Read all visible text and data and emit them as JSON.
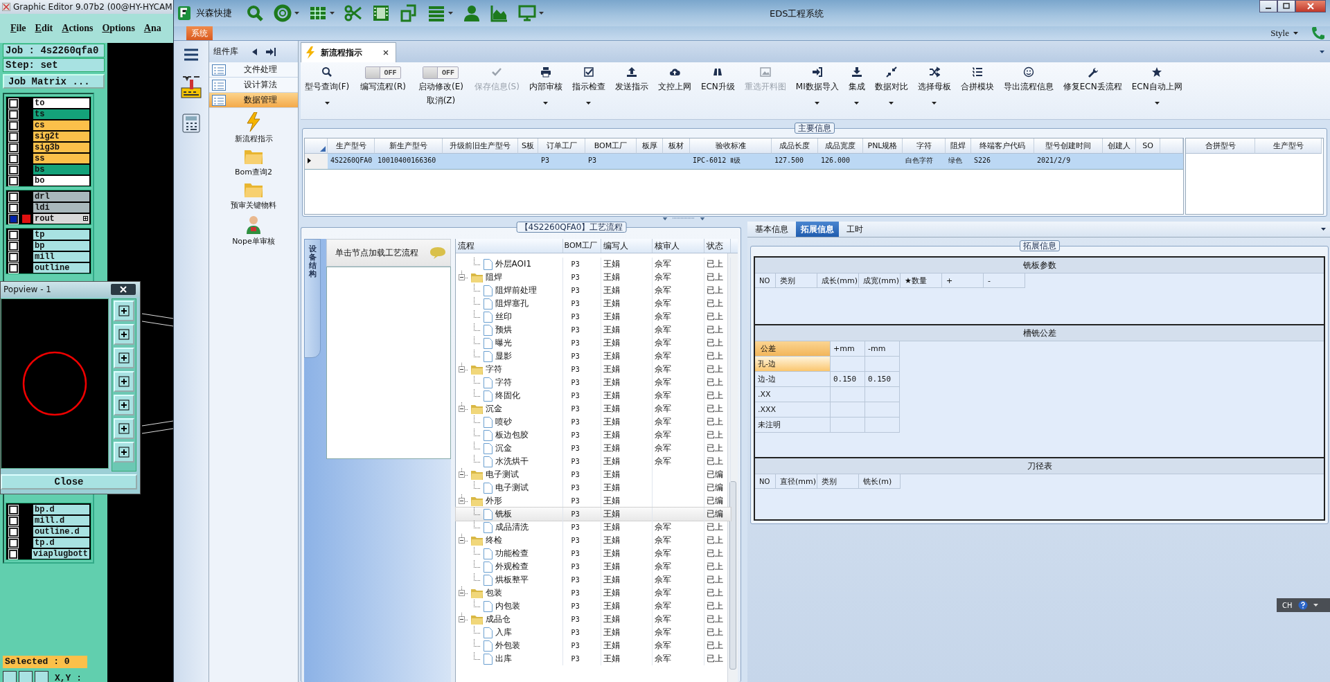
{
  "genesis": {
    "title": "Graphic Editor 9.07b2 (00@HY-HYCAM",
    "menu": [
      "File",
      "Edit",
      "Actions",
      "Options",
      "Ana"
    ],
    "job": "Job : 4s2260qfa0",
    "step": "Step: set",
    "matrix_button": "Job Matrix ...",
    "layer_groups": [
      [
        {
          "name": "to",
          "color": "#ffffff",
          "checked": false,
          "work_layer": false
        },
        {
          "name": "ts",
          "color": "#14a27a",
          "checked": false,
          "work_layer": false
        },
        {
          "name": "cs",
          "color": "#fbc04a",
          "checked": false,
          "work_layer": false
        },
        {
          "name": "sig2t",
          "color": "#fbc04a",
          "checked": false,
          "work_layer": false
        },
        {
          "name": "sig3b",
          "color": "#fbc04a",
          "checked": false,
          "work_layer": false
        },
        {
          "name": "ss",
          "color": "#fbc04a",
          "checked": false,
          "work_layer": false
        },
        {
          "name": "bs",
          "color": "#14a27a",
          "checked": false,
          "work_layer": false
        },
        {
          "name": "bo",
          "color": "#ffffff",
          "checked": false,
          "work_layer": false
        }
      ],
      [
        {
          "name": "drl",
          "color": "#a9b8bc",
          "checked": false,
          "work_layer": false
        },
        {
          "name": "ldi",
          "color": "#a9b8bc",
          "checked": false,
          "work_layer": false
        },
        {
          "name": "rout",
          "color": "#d9d9d9",
          "checked": true,
          "work_layer": true
        }
      ],
      [
        {
          "name": "tp",
          "color": "#a8e2e2",
          "checked": false,
          "work_layer": false
        },
        {
          "name": "bp",
          "color": "#a8e2e2",
          "checked": false,
          "work_layer": false
        },
        {
          "name": "mill",
          "color": "#a8e2e2",
          "checked": false,
          "work_layer": false
        },
        {
          "name": "outline",
          "color": "#a8e2e2",
          "checked": false,
          "work_layer": false
        }
      ]
    ],
    "lower_layers": [
      {
        "name": "bp.d",
        "color": "#a8e2e2",
        "checked": false,
        "work_layer": false
      },
      {
        "name": "mill.d",
        "color": "#a8e2e2",
        "checked": false,
        "work_layer": false
      },
      {
        "name": "outline.d",
        "color": "#a8e2e2",
        "checked": false,
        "work_layer": false
      },
      {
        "name": "tp.d",
        "color": "#a8e2e2",
        "checked": false,
        "work_layer": false
      },
      {
        "name": "viaplugbott",
        "color": "#a8e2e2",
        "checked": false,
        "work_layer": false
      }
    ],
    "selected_count": "Selected : 0",
    "coords_label": "X,Y :"
  },
  "popview": {
    "title": "Popview - 1",
    "close_button": "Close"
  },
  "eds": {
    "title": "EDS工程系统",
    "brand": "兴森快捷",
    "ribbon_tab": "系统",
    "style_menu": "Style",
    "component_panel": {
      "title": "组件库",
      "items": [
        {
          "label": "文件处理",
          "selected": false
        },
        {
          "label": "设计算法",
          "selected": false
        },
        {
          "label": "数据管理",
          "selected": true
        }
      ],
      "tools": [
        "新流程指示",
        "Bom查询2",
        "预审关键物料",
        "Nope单审核"
      ]
    },
    "doc_tabs": [
      {
        "label": "新流程指示",
        "selected": true
      }
    ],
    "toolbar": [
      {
        "kind": "button",
        "label": "型号查询(F)",
        "dropdown": true,
        "disabled": false
      },
      {
        "kind": "toggle",
        "label": "编写流程(R)",
        "switch_text": "OFF",
        "on": false
      },
      {
        "kind": "toggle",
        "label": "启动修改(E)",
        "label2": "取消(Z)",
        "switch_text": "OFF",
        "on": false
      },
      {
        "kind": "button",
        "label": "保存信息(S)",
        "dropdown": false,
        "disabled": true
      },
      {
        "kind": "button",
        "label": "内部审核",
        "dropdown": true,
        "disabled": false
      },
      {
        "kind": "button",
        "label": "指示检查",
        "dropdown": true,
        "disabled": false
      },
      {
        "kind": "button",
        "label": "发送指示",
        "dropdown": false,
        "disabled": false
      },
      {
        "kind": "button",
        "label": "文控上网",
        "dropdown": false,
        "disabled": false
      },
      {
        "kind": "button",
        "label": "ECN升级",
        "dropdown": false,
        "disabled": false
      },
      {
        "kind": "button",
        "label": "重选开料图",
        "dropdown": false,
        "disabled": true
      },
      {
        "kind": "button",
        "label": "MI数据导入",
        "dropdown": true,
        "disabled": false
      },
      {
        "kind": "button",
        "label": "集成",
        "dropdown": true,
        "disabled": false
      },
      {
        "kind": "button",
        "label": "数据对比",
        "dropdown": true,
        "disabled": false
      },
      {
        "kind": "button",
        "label": "选择母板",
        "dropdown": true,
        "disabled": false
      },
      {
        "kind": "button",
        "label": "合拼模块",
        "dropdown": false,
        "disabled": false
      },
      {
        "kind": "button",
        "label": "导出流程信息",
        "dropdown": false,
        "disabled": false
      },
      {
        "kind": "button",
        "label": "修复ECN丢流程",
        "dropdown": false,
        "disabled": false
      },
      {
        "kind": "button",
        "label": "ECN自动上网",
        "dropdown": true,
        "disabled": false
      }
    ],
    "main_info": {
      "title": "主要信息",
      "columns": [
        "生产型号",
        "新生产型号",
        "升级前旧生产型号",
        "S板",
        "订单工厂",
        "BOM工厂",
        "板厚",
        "板材",
        "验收标准",
        "成品长度",
        "成品宽度",
        "PNL规格",
        "字符",
        "阻焊",
        "终端客户代码",
        "型号创建时间",
        "创建人",
        "SO"
      ],
      "rows": [
        {
          "selected": true,
          "cells": [
            "4S2260QFA0",
            "10010400166360",
            null,
            null,
            "P3",
            "P3",
            null,
            null,
            "IPC-6012 Ⅱ级",
            "127.500",
            "126.000",
            null,
            "白色字符",
            "绿色",
            "S226",
            "2021/2/9",
            null,
            null
          ]
        }
      ],
      "side_columns": [
        "合拼型号",
        "生产型号"
      ]
    },
    "process": {
      "title": "【4S2260QFA0】工艺流程",
      "side_tab": "设备结构",
      "hint": "单击节点加载工艺流程",
      "columns": [
        "流程",
        "BOM工厂",
        "编写人",
        "核审人",
        "状态"
      ],
      "tree": [
        {
          "children": [
            {
              "label": "外层AOI1",
              "bom": "P3",
              "writer": "王娟",
              "reviewer": "佘军",
              "status": "已上",
              "selected": false
            }
          ]
        },
        {
          "label": "阻焊",
          "bom": "P3",
          "writer": "王娟",
          "reviewer": "佘军",
          "status": "已上",
          "expanded": true,
          "selected": false,
          "children": [
            {
              "label": "阻焊前处理",
              "bom": "P3",
              "writer": "王娟",
              "reviewer": "佘军",
              "status": "已上",
              "selected": false
            },
            {
              "label": "阻焊塞孔",
              "bom": "P3",
              "writer": "王娟",
              "reviewer": "佘军",
              "status": "已上",
              "selected": false
            },
            {
              "label": "丝印",
              "bom": "P3",
              "writer": "王娟",
              "reviewer": "佘军",
              "status": "已上",
              "selected": false
            },
            {
              "label": "预烘",
              "bom": "P3",
              "writer": "王娟",
              "reviewer": "佘军",
              "status": "已上",
              "selected": false
            },
            {
              "label": "曝光",
              "bom": "P3",
              "writer": "王娟",
              "reviewer": "佘军",
              "status": "已上",
              "selected": false
            },
            {
              "label": "显影",
              "bom": "P3",
              "writer": "王娟",
              "reviewer": "佘军",
              "status": "已上",
              "selected": false
            }
          ]
        },
        {
          "label": "字符",
          "bom": "P3",
          "writer": "王娟",
          "reviewer": "佘军",
          "status": "已上",
          "expanded": true,
          "selected": false,
          "children": [
            {
              "label": "字符",
              "bom": "P3",
              "writer": "王娟",
              "reviewer": "佘军",
              "status": "已上",
              "selected": false
            },
            {
              "label": "终固化",
              "bom": "P3",
              "writer": "王娟",
              "reviewer": "佘军",
              "status": "已上",
              "selected": false
            }
          ]
        },
        {
          "label": "沉金",
          "bom": "P3",
          "writer": "王娟",
          "reviewer": "佘军",
          "status": "已上",
          "expanded": true,
          "selected": false,
          "children": [
            {
              "label": "喷砂",
              "bom": "P3",
              "writer": "王娟",
              "reviewer": "佘军",
              "status": "已上",
              "selected": false
            },
            {
              "label": "板边包胶",
              "bom": "P3",
              "writer": "王娟",
              "reviewer": "佘军",
              "status": "已上",
              "selected": false
            },
            {
              "label": "沉金",
              "bom": "P3",
              "writer": "王娟",
              "reviewer": "佘军",
              "status": "已上",
              "selected": false
            },
            {
              "label": "水洗烘干",
              "bom": "P3",
              "writer": "王娟",
              "reviewer": "佘军",
              "status": "已上",
              "selected": false
            }
          ]
        },
        {
          "label": "电子测试",
          "bom": "P3",
          "writer": "王娟",
          "status": "已编",
          "expanded": true,
          "selected": false,
          "children": [
            {
              "label": "电子测试",
              "bom": "P3",
              "writer": "王娟",
              "status": "已编",
              "selected": false
            }
          ]
        },
        {
          "label": "外形",
          "bom": "P3",
          "writer": "王娟",
          "status": "已编",
          "expanded": true,
          "selected": false,
          "children": [
            {
              "label": "铣板",
              "bom": "P3",
              "writer": "王娟",
              "status": "已编",
              "selected": true
            },
            {
              "label": "成品清洗",
              "bom": "P3",
              "writer": "王娟",
              "reviewer": "佘军",
              "status": "已上",
              "selected": false
            }
          ]
        },
        {
          "label": "终检",
          "bom": "P3",
          "writer": "王娟",
          "reviewer": "佘军",
          "status": "已上",
          "expanded": true,
          "selected": false,
          "children": [
            {
              "label": "功能检查",
              "bom": "P3",
              "writer": "王娟",
              "reviewer": "佘军",
              "status": "已上",
              "selected": false
            },
            {
              "label": "外观检查",
              "bom": "P3",
              "writer": "王娟",
              "reviewer": "佘军",
              "status": "已上",
              "selected": false
            },
            {
              "label": "烘板整平",
              "bom": "P3",
              "writer": "王娟",
              "reviewer": "佘军",
              "status": "已上",
              "selected": false
            }
          ]
        },
        {
          "label": "包装",
          "bom": "P3",
          "writer": "王娟",
          "reviewer": "佘军",
          "status": "已上",
          "expanded": true,
          "selected": false,
          "children": [
            {
              "label": "内包装",
              "bom": "P3",
              "writer": "王娟",
              "reviewer": "佘军",
              "status": "已上",
              "selected": false
            }
          ]
        },
        {
          "label": "成品仓",
          "bom": "P3",
          "writer": "王娟",
          "reviewer": "佘军",
          "status": "已上",
          "expanded": true,
          "selected": false,
          "children": [
            {
              "label": "入库",
              "bom": "P3",
              "writer": "王娟",
              "reviewer": "佘军",
              "status": "已上",
              "selected": false
            },
            {
              "label": "外包装",
              "bom": "P3",
              "writer": "王娟",
              "reviewer": "佘军",
              "status": "已上",
              "selected": false
            },
            {
              "label": "出库",
              "bom": "P3",
              "writer": "王娟",
              "reviewer": "佘军",
              "status": "已上",
              "selected": false
            }
          ]
        }
      ]
    },
    "detail": {
      "tabs": [
        {
          "label": "基本信息",
          "selected": false
        },
        {
          "label": "拓展信息",
          "selected": true
        },
        {
          "label": "工时",
          "selected": false
        }
      ],
      "group_title": "拓展信息",
      "sections": [
        {
          "kind": "grid",
          "title": "铣板参数",
          "columns": [
            "NO",
            "类别",
            "成长(mm)",
            "成宽(mm)",
            "★数量",
            "+",
            "-"
          ]
        },
        {
          "kind": "tolerance",
          "title": "槽铣公差",
          "columns": [
            "公差",
            "+mm",
            "-mm"
          ],
          "rows": [
            {
              "label": "孔-边",
              "selected": true
            },
            {
              "label": "边-边",
              "values": [
                "0.150",
                "0.150"
              ],
              "selected": false
            },
            {
              "label": ".XX",
              "selected": false
            },
            {
              "label": ".XXX",
              "selected": false
            },
            {
              "label": "未注明",
              "selected": false
            }
          ]
        },
        {
          "kind": "grid",
          "title": "刀径表",
          "columns": [
            "NO",
            "直径(mm)",
            "类别",
            "铣长(m)"
          ]
        }
      ]
    },
    "language_bar": {
      "label": "CH"
    }
  }
}
